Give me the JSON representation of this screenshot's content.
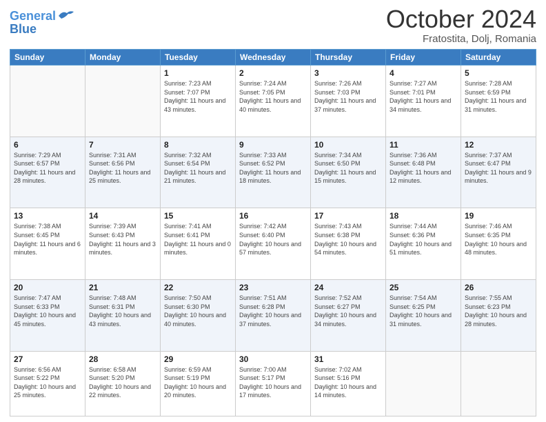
{
  "header": {
    "logo_line1": "General",
    "logo_line2": "Blue",
    "month_title": "October 2024",
    "location": "Fratostita, Dolj, Romania"
  },
  "weekdays": [
    "Sunday",
    "Monday",
    "Tuesday",
    "Wednesday",
    "Thursday",
    "Friday",
    "Saturday"
  ],
  "weeks": [
    [
      {
        "day": "",
        "sunrise": "",
        "sunset": "",
        "daylight": ""
      },
      {
        "day": "",
        "sunrise": "",
        "sunset": "",
        "daylight": ""
      },
      {
        "day": "1",
        "sunrise": "Sunrise: 7:23 AM",
        "sunset": "Sunset: 7:07 PM",
        "daylight": "Daylight: 11 hours and 43 minutes."
      },
      {
        "day": "2",
        "sunrise": "Sunrise: 7:24 AM",
        "sunset": "Sunset: 7:05 PM",
        "daylight": "Daylight: 11 hours and 40 minutes."
      },
      {
        "day": "3",
        "sunrise": "Sunrise: 7:26 AM",
        "sunset": "Sunset: 7:03 PM",
        "daylight": "Daylight: 11 hours and 37 minutes."
      },
      {
        "day": "4",
        "sunrise": "Sunrise: 7:27 AM",
        "sunset": "Sunset: 7:01 PM",
        "daylight": "Daylight: 11 hours and 34 minutes."
      },
      {
        "day": "5",
        "sunrise": "Sunrise: 7:28 AM",
        "sunset": "Sunset: 6:59 PM",
        "daylight": "Daylight: 11 hours and 31 minutes."
      }
    ],
    [
      {
        "day": "6",
        "sunrise": "Sunrise: 7:29 AM",
        "sunset": "Sunset: 6:57 PM",
        "daylight": "Daylight: 11 hours and 28 minutes."
      },
      {
        "day": "7",
        "sunrise": "Sunrise: 7:31 AM",
        "sunset": "Sunset: 6:56 PM",
        "daylight": "Daylight: 11 hours and 25 minutes."
      },
      {
        "day": "8",
        "sunrise": "Sunrise: 7:32 AM",
        "sunset": "Sunset: 6:54 PM",
        "daylight": "Daylight: 11 hours and 21 minutes."
      },
      {
        "day": "9",
        "sunrise": "Sunrise: 7:33 AM",
        "sunset": "Sunset: 6:52 PM",
        "daylight": "Daylight: 11 hours and 18 minutes."
      },
      {
        "day": "10",
        "sunrise": "Sunrise: 7:34 AM",
        "sunset": "Sunset: 6:50 PM",
        "daylight": "Daylight: 11 hours and 15 minutes."
      },
      {
        "day": "11",
        "sunrise": "Sunrise: 7:36 AM",
        "sunset": "Sunset: 6:48 PM",
        "daylight": "Daylight: 11 hours and 12 minutes."
      },
      {
        "day": "12",
        "sunrise": "Sunrise: 7:37 AM",
        "sunset": "Sunset: 6:47 PM",
        "daylight": "Daylight: 11 hours and 9 minutes."
      }
    ],
    [
      {
        "day": "13",
        "sunrise": "Sunrise: 7:38 AM",
        "sunset": "Sunset: 6:45 PM",
        "daylight": "Daylight: 11 hours and 6 minutes."
      },
      {
        "day": "14",
        "sunrise": "Sunrise: 7:39 AM",
        "sunset": "Sunset: 6:43 PM",
        "daylight": "Daylight: 11 hours and 3 minutes."
      },
      {
        "day": "15",
        "sunrise": "Sunrise: 7:41 AM",
        "sunset": "Sunset: 6:41 PM",
        "daylight": "Daylight: 11 hours and 0 minutes."
      },
      {
        "day": "16",
        "sunrise": "Sunrise: 7:42 AM",
        "sunset": "Sunset: 6:40 PM",
        "daylight": "Daylight: 10 hours and 57 minutes."
      },
      {
        "day": "17",
        "sunrise": "Sunrise: 7:43 AM",
        "sunset": "Sunset: 6:38 PM",
        "daylight": "Daylight: 10 hours and 54 minutes."
      },
      {
        "day": "18",
        "sunrise": "Sunrise: 7:44 AM",
        "sunset": "Sunset: 6:36 PM",
        "daylight": "Daylight: 10 hours and 51 minutes."
      },
      {
        "day": "19",
        "sunrise": "Sunrise: 7:46 AM",
        "sunset": "Sunset: 6:35 PM",
        "daylight": "Daylight: 10 hours and 48 minutes."
      }
    ],
    [
      {
        "day": "20",
        "sunrise": "Sunrise: 7:47 AM",
        "sunset": "Sunset: 6:33 PM",
        "daylight": "Daylight: 10 hours and 45 minutes."
      },
      {
        "day": "21",
        "sunrise": "Sunrise: 7:48 AM",
        "sunset": "Sunset: 6:31 PM",
        "daylight": "Daylight: 10 hours and 43 minutes."
      },
      {
        "day": "22",
        "sunrise": "Sunrise: 7:50 AM",
        "sunset": "Sunset: 6:30 PM",
        "daylight": "Daylight: 10 hours and 40 minutes."
      },
      {
        "day": "23",
        "sunrise": "Sunrise: 7:51 AM",
        "sunset": "Sunset: 6:28 PM",
        "daylight": "Daylight: 10 hours and 37 minutes."
      },
      {
        "day": "24",
        "sunrise": "Sunrise: 7:52 AM",
        "sunset": "Sunset: 6:27 PM",
        "daylight": "Daylight: 10 hours and 34 minutes."
      },
      {
        "day": "25",
        "sunrise": "Sunrise: 7:54 AM",
        "sunset": "Sunset: 6:25 PM",
        "daylight": "Daylight: 10 hours and 31 minutes."
      },
      {
        "day": "26",
        "sunrise": "Sunrise: 7:55 AM",
        "sunset": "Sunset: 6:23 PM",
        "daylight": "Daylight: 10 hours and 28 minutes."
      }
    ],
    [
      {
        "day": "27",
        "sunrise": "Sunrise: 6:56 AM",
        "sunset": "Sunset: 5:22 PM",
        "daylight": "Daylight: 10 hours and 25 minutes."
      },
      {
        "day": "28",
        "sunrise": "Sunrise: 6:58 AM",
        "sunset": "Sunset: 5:20 PM",
        "daylight": "Daylight: 10 hours and 22 minutes."
      },
      {
        "day": "29",
        "sunrise": "Sunrise: 6:59 AM",
        "sunset": "Sunset: 5:19 PM",
        "daylight": "Daylight: 10 hours and 20 minutes."
      },
      {
        "day": "30",
        "sunrise": "Sunrise: 7:00 AM",
        "sunset": "Sunset: 5:17 PM",
        "daylight": "Daylight: 10 hours and 17 minutes."
      },
      {
        "day": "31",
        "sunrise": "Sunrise: 7:02 AM",
        "sunset": "Sunset: 5:16 PM",
        "daylight": "Daylight: 10 hours and 14 minutes."
      },
      {
        "day": "",
        "sunrise": "",
        "sunset": "",
        "daylight": ""
      },
      {
        "day": "",
        "sunrise": "",
        "sunset": "",
        "daylight": ""
      }
    ]
  ]
}
